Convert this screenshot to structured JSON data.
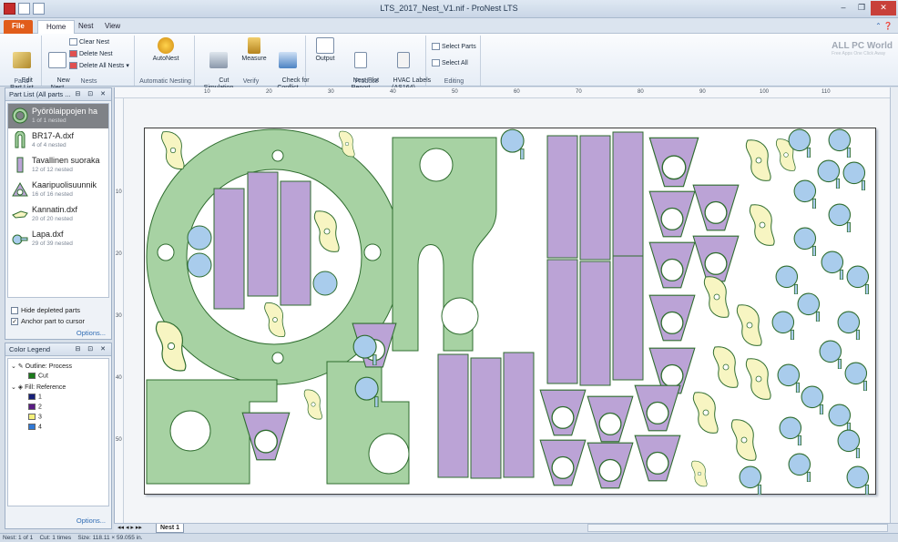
{
  "window": {
    "title": "LTS_2017_Nest_V1.nif - ProNest LTS",
    "min": "–",
    "max": "❐",
    "close": "✕"
  },
  "tabs": [
    {
      "label": "File"
    },
    {
      "label": "Home"
    },
    {
      "label": "Nest"
    },
    {
      "label": "View"
    }
  ],
  "ribbon": {
    "parts_group": {
      "label": "Parts",
      "edit_part_list": "Edit\nPart List"
    },
    "nests_group": {
      "label": "Nests",
      "new_nest": "New\nNest",
      "clear_nest": "Clear Nest",
      "delete_nest": "Delete Nest",
      "delete_all_nests": "Delete All Nests"
    },
    "auto_group": {
      "label": "Automatic Nesting",
      "autonest": "AutoNest"
    },
    "verify_group": {
      "label": "Verify",
      "cut_simulation": "Cut\nSimulation",
      "measure": "Measure",
      "check_conflict": "Check for\nConflict"
    },
    "produce_group": {
      "label": "Produce",
      "output": "Output",
      "nest_plot_report": "Nest Plot\nReport",
      "hvac_labels": "HVAC Labels\n(AS164)"
    },
    "editing_group": {
      "label": "Editing",
      "select_parts": "Select Parts",
      "select_all": "Select All"
    }
  },
  "watermark": {
    "title": "ALL PC World",
    "subtitle": "Free Apps One Click Away"
  },
  "part_list": {
    "title": "Part List  (All parts ...",
    "items": [
      {
        "name": "Pyörölaippojen ha",
        "count": "1 of 1 nested",
        "icon": "ring-part-icon"
      },
      {
        "name": "BR17-A.dxf",
        "count": "4 of 4 nested",
        "icon": "bracket-part-icon"
      },
      {
        "name": "Tavallinen suoraka",
        "count": "12 of 12 nested",
        "icon": "rectangle-part-icon"
      },
      {
        "name": "Kaaripuolisuunnik",
        "count": "16 of 16 nested",
        "icon": "trapezoid-part-icon"
      },
      {
        "name": "Kannatin.dxf",
        "count": "20 of 20 nested",
        "icon": "support-part-icon"
      },
      {
        "name": "Lapa.dxf",
        "count": "29 of 39 nested",
        "icon": "blade-part-icon"
      }
    ],
    "hide_depleted": "Hide depleted parts",
    "anchor_to_cursor": "Anchor part to cursor",
    "options": "Options..."
  },
  "color_legend": {
    "title": "Color Legend",
    "outline_header": "Outline: Process",
    "outline_items": [
      {
        "label": "Cut",
        "color": "#1a7a1a"
      }
    ],
    "fill_header": "Fill: Reference",
    "fill_items": [
      {
        "label": "1",
        "color": "#17207a"
      },
      {
        "label": "2",
        "color": "#5a1c84"
      },
      {
        "label": "3",
        "color": "#f5f07a"
      },
      {
        "label": "4",
        "color": "#2f78d6"
      }
    ],
    "options": "Options..."
  },
  "ruler": {
    "h_labels": [
      "10",
      "20",
      "30",
      "40",
      "50",
      "60",
      "70",
      "80",
      "90",
      "100",
      "110"
    ],
    "v_labels": [
      "10",
      "20",
      "30",
      "40",
      "50"
    ]
  },
  "nest_tab": {
    "label": "Nest 1"
  },
  "status": {
    "nest": "Nest: 1 of 1",
    "cut": "Cut: 1 times",
    "size": "Size: 118.11 × 59.055 in."
  },
  "colors": {
    "green_fill": "#a7d2a3",
    "purple_fill": "#bba3d6",
    "yellow_fill": "#f7f5c2",
    "blue_fill": "#a9ccec",
    "outline": "#2f6d2f"
  }
}
